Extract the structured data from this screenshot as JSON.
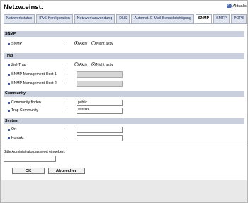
{
  "header": {
    "title": "Netzw.einst.",
    "update_label": "Aktualisi"
  },
  "tabs": [
    {
      "label": "Netzwerkstatus"
    },
    {
      "label": "IPv6-Konfiguration"
    },
    {
      "label": "Netzwerkanwendung"
    },
    {
      "label": "DNS"
    },
    {
      "label": "Automat. E-Mail-Benachrichtigung"
    },
    {
      "label": "SNMP",
      "active": true
    },
    {
      "label": "SMTP"
    },
    {
      "label": "POP3"
    }
  ],
  "sections": {
    "snmp": {
      "title": "SNMP",
      "rows": [
        {
          "label": "SNMP",
          "options": [
            "Aktiv",
            "Nicht aktiv"
          ],
          "selected": "Aktiv"
        }
      ]
    },
    "trap": {
      "title": "Trap",
      "rows": [
        {
          "label": "Ziel-Trap",
          "options": [
            "Aktiv",
            "Nicht aktiv"
          ],
          "selected": "Nicht aktiv"
        },
        {
          "label": "SNMP-Management-Host 1",
          "value": ""
        },
        {
          "label": "SNMP-Management-Host 2",
          "value": ""
        }
      ]
    },
    "community": {
      "title": "Community",
      "rows": [
        {
          "label": "Community finden",
          "value": "public"
        },
        {
          "label": "Trap Community",
          "value": "********"
        }
      ]
    },
    "system": {
      "title": "System",
      "rows": [
        {
          "label": "Ort",
          "value": ""
        },
        {
          "label": "Kontakt",
          "value": ""
        }
      ]
    }
  },
  "colon": ":",
  "footer": {
    "password_prompt": "Bitte Administratorpasswort eingeben.",
    "ok_label": "OK",
    "cancel_label": "Abbrechen"
  }
}
